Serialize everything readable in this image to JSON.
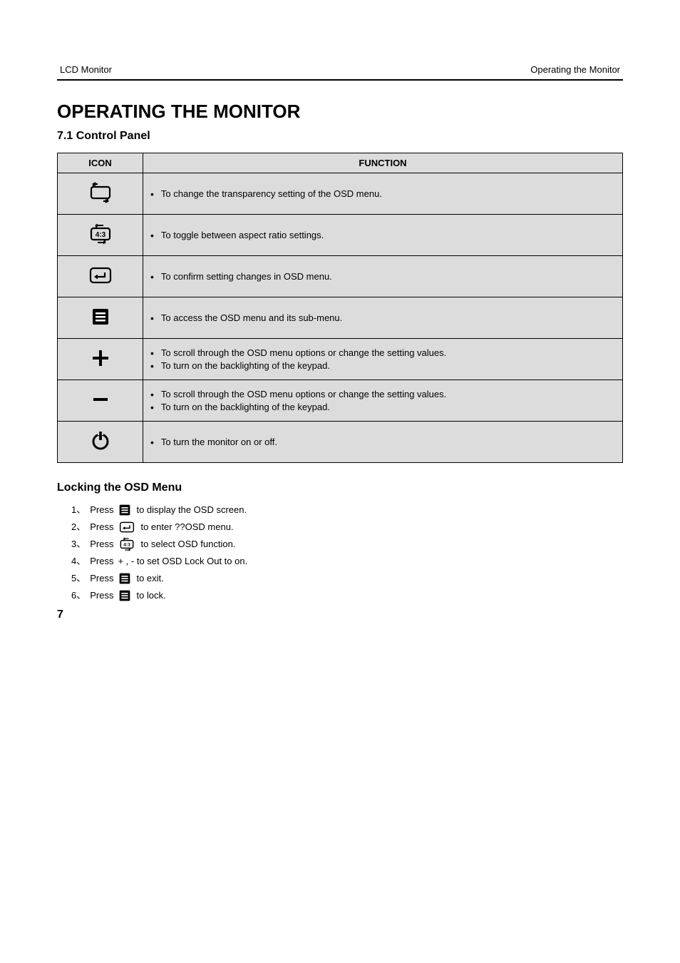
{
  "header": {
    "left": "LCD Monitor",
    "right": "Operating the Monitor"
  },
  "title": "OPERATING THE MONITOR",
  "subtitle": "7.1 Control Panel",
  "table": {
    "head_icon": "ICON",
    "head_func": "FUNCTION",
    "rows": [
      {
        "icon": "transparency",
        "text": "To change the transparency setting of the OSD menu."
      },
      {
        "icon": "aspect",
        "text": "To toggle between aspect ratio settings."
      },
      {
        "icon": "enter",
        "text": "To confirm setting changes in OSD menu."
      },
      {
        "icon": "menu",
        "text": "To access the OSD menu and its sub-menu."
      },
      {
        "icon": "plus",
        "text": "— To scroll through the OSD menu options or change the setting values.\n— To turn on the backlighting of the keypad."
      },
      {
        "icon": "minus",
        "text": "— To scroll through the OSD menu options or change the setting values.\n— To turn on the backlighting of the keypad."
      },
      {
        "icon": "power",
        "text": "To turn the monitor on or off."
      }
    ]
  },
  "locking": {
    "title": "Locking the OSD Menu",
    "steps": [
      {
        "pre": "Press ",
        "icon": "menu",
        "post": " to display the OSD screen."
      },
      {
        "pre": "Press ",
        "icon": "enter",
        "post": " to enter ??OSD menu."
      },
      {
        "pre": "Press ",
        "icon": "aspect",
        "post": " to select OSD function."
      },
      {
        "pre": "Press ",
        "icon": null,
        "post": "+ , - to set OSD Lock Out to on."
      },
      {
        "pre": "Press ",
        "icon": "menu",
        "post": " to exit."
      },
      {
        "pre": "Press ",
        "icon": "menu",
        "post": " to lock."
      }
    ]
  },
  "footnum": "7"
}
